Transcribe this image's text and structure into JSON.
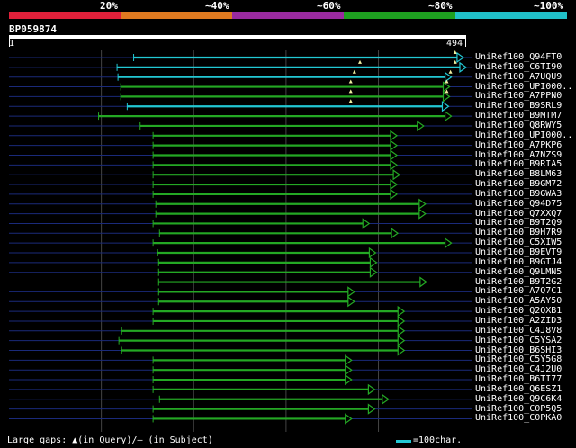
{
  "identity_legend": [
    {
      "label": "20%",
      "color": "#e0203a"
    },
    {
      "label": "~40%",
      "color": "#e07a20"
    },
    {
      "label": "~60%",
      "color": "#9a2aa0"
    },
    {
      "label": "~80%",
      "color": "#1ea020"
    },
    {
      "label": "~100%",
      "color": "#20c0c8"
    }
  ],
  "query": {
    "id": "BP059874",
    "start": "1",
    "end": "494"
  },
  "hits": [
    {
      "name": "UniRef100_Q94FT0",
      "start": 135,
      "end": 491,
      "color": "cyan",
      "gaps": [
        483
      ]
    },
    {
      "name": "UniRef100_C6TI90",
      "start": 117,
      "end": 494,
      "color": "cyan",
      "gaps": [
        380,
        483
      ]
    },
    {
      "name": "UniRef100_A7UQU9",
      "start": 118,
      "end": 478,
      "color": "cyan",
      "gaps": [
        374,
        478
      ]
    },
    {
      "name": "UniRef100_UPI000..",
      "start": 121,
      "end": 476,
      "color": "green",
      "gaps": [
        370,
        474
      ]
    },
    {
      "name": "UniRef100_A7PPN0",
      "start": 121,
      "end": 476,
      "color": "green",
      "gaps": [
        370,
        474
      ]
    },
    {
      "name": "UniRef100_B9SRL9",
      "start": 128,
      "end": 475,
      "color": "cyan",
      "gaps": [
        370
      ]
    },
    {
      "name": "UniRef100_B9MTM7",
      "start": 97,
      "end": 478,
      "color": "green",
      "gaps": []
    },
    {
      "name": "UniRef100_Q8RWY5",
      "start": 142,
      "end": 448,
      "color": "green",
      "gaps": []
    },
    {
      "name": "UniRef100_UPI000..",
      "start": 156,
      "end": 419,
      "color": "green",
      "gaps": []
    },
    {
      "name": "UniRef100_A7PKP6",
      "start": 156,
      "end": 419,
      "color": "green",
      "gaps": []
    },
    {
      "name": "UniRef100_A7NZS9",
      "start": 156,
      "end": 419,
      "color": "green",
      "gaps": []
    },
    {
      "name": "UniRef100_B9RIA5",
      "start": 156,
      "end": 419,
      "color": "green",
      "gaps": []
    },
    {
      "name": "UniRef100_B8LM63",
      "start": 156,
      "end": 422,
      "color": "green",
      "gaps": []
    },
    {
      "name": "UniRef100_B9GM72",
      "start": 156,
      "end": 419,
      "color": "green",
      "gaps": []
    },
    {
      "name": "UniRef100_B9GWA3",
      "start": 156,
      "end": 419,
      "color": "green",
      "gaps": []
    },
    {
      "name": "UniRef100_Q94D75",
      "start": 159,
      "end": 450,
      "color": "green",
      "gaps": []
    },
    {
      "name": "UniRef100_Q7XXQ7",
      "start": 159,
      "end": 450,
      "color": "green",
      "gaps": []
    },
    {
      "name": "UniRef100_B9T2Q9",
      "start": 156,
      "end": 389,
      "color": "green",
      "gaps": []
    },
    {
      "name": "UniRef100_B9H7R9",
      "start": 163,
      "end": 420,
      "color": "green",
      "gaps": []
    },
    {
      "name": "UniRef100_C5XIW5",
      "start": 156,
      "end": 478,
      "color": "green",
      "gaps": []
    },
    {
      "name": "UniRef100_B9EVT9",
      "start": 161,
      "end": 396,
      "color": "green",
      "gaps": []
    },
    {
      "name": "UniRef100_B9GTJ4",
      "start": 162,
      "end": 397,
      "color": "green",
      "gaps": []
    },
    {
      "name": "UniRef100_Q9LMN5",
      "start": 162,
      "end": 397,
      "color": "green",
      "gaps": []
    },
    {
      "name": "UniRef100_B9T2G2",
      "start": 162,
      "end": 451,
      "color": "green",
      "gaps": []
    },
    {
      "name": "UniRef100_A7Q7C1",
      "start": 162,
      "end": 373,
      "color": "green",
      "gaps": []
    },
    {
      "name": "UniRef100_A5AY50",
      "start": 162,
      "end": 373,
      "color": "green",
      "gaps": []
    },
    {
      "name": "UniRef100_Q2QXB1",
      "start": 156,
      "end": 427,
      "color": "green",
      "gaps": []
    },
    {
      "name": "UniRef100_A2ZID3",
      "start": 156,
      "end": 427,
      "color": "green",
      "gaps": []
    },
    {
      "name": "UniRef100_C4J8V8",
      "start": 122,
      "end": 427,
      "color": "green",
      "gaps": []
    },
    {
      "name": "UniRef100_C5YSA2",
      "start": 119,
      "end": 427,
      "color": "green",
      "gaps": []
    },
    {
      "name": "UniRef100_B6SHI3",
      "start": 122,
      "end": 427,
      "color": "green",
      "gaps": []
    },
    {
      "name": "UniRef100_C5Y5G8",
      "start": 156,
      "end": 370,
      "color": "green",
      "gaps": []
    },
    {
      "name": "UniRef100_C4J2U0",
      "start": 156,
      "end": 370,
      "color": "green",
      "gaps": []
    },
    {
      "name": "UniRef100_B6TI77",
      "start": 156,
      "end": 370,
      "color": "green",
      "gaps": []
    },
    {
      "name": "UniRef100_Q6ESZ1",
      "start": 156,
      "end": 395,
      "color": "green",
      "gaps": []
    },
    {
      "name": "UniRef100_Q9C6K4",
      "start": 163,
      "end": 410,
      "color": "green",
      "gaps": []
    },
    {
      "name": "UniRef100_C0P5Q5",
      "start": 156,
      "end": 395,
      "color": "green",
      "gaps": []
    },
    {
      "name": "UniRef100_C0PKA0",
      "start": 156,
      "end": 370,
      "color": "green",
      "gaps": []
    }
  ],
  "gridlines_at": [
    100,
    200,
    300,
    400
  ],
  "colors": {
    "cyan": "#22c8d4",
    "green": "#24a824",
    "axis": "#1a2a7a",
    "grid": "#444444"
  },
  "footer": {
    "text": "Large gaps: ▲(in Query)/— (in Subject)",
    "scale_label": "=100char."
  }
}
